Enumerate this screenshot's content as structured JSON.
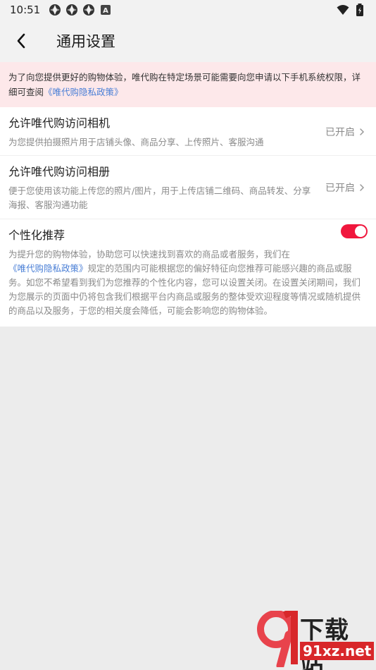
{
  "status_bar": {
    "time": "10:51",
    "badge_letter": "A"
  },
  "header": {
    "title": "通用设置"
  },
  "notice": {
    "text": "为了向您提供更好的购物体验，唯代购在特定场景可能需要向您申请以下手机系统权限，详细可查阅",
    "link": "《唯代购隐私政策》"
  },
  "settings": {
    "camera": {
      "title": "允许唯代购访问相机",
      "desc": "为您提供拍摄照片用于店铺头像、商品分享、上传照片、客服沟通",
      "status": "已开启"
    },
    "album": {
      "title": "允许唯代购访问相册",
      "desc": "便于您使用该功能上传您的照片/图片，用于上传店铺二维码、商品转发、分享海报、客服沟通功能",
      "status": "已开启"
    },
    "recommend": {
      "title": "个性化推荐",
      "desc_before": "为提升您的购物体验，协助您可以快速找到喜欢的商品或者服务，我们在",
      "desc_link": "《唯代购隐私政策》",
      "desc_after": "规定的范围内可能根据您的偏好特征向您推荐可能感兴趣的商品或服务。如您不希望看到我们为您推荐的个性化内容，您可以设置关闭。在设置关闭期间，我们为您展示的页面中仍将包含我们根据平台内商品或服务的整体受欢迎程度等情况或随机提供的商品以及服务，于您的相关度会降低，可能会影响您的购物体验。",
      "toggle_on": true
    }
  },
  "watermark": {
    "title": "下载站",
    "domain": "91xz.net"
  },
  "colors": {
    "accent": "#f0173d",
    "link": "#4a7fd6",
    "notice_bg": "#fde8ea"
  }
}
